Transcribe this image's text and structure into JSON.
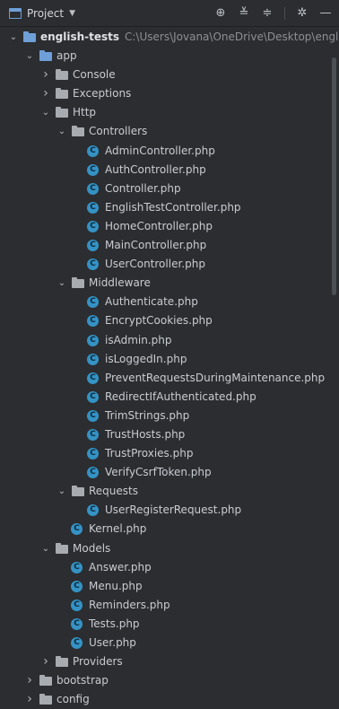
{
  "header": {
    "title": "Project",
    "caret_icon": "dropdown-caret-icon",
    "tools": [
      "locate-icon",
      "expand-all-icon",
      "collapse-all-icon",
      "settings-icon",
      "hide-icon"
    ]
  },
  "tree": [
    {
      "label": "english-tests",
      "path": "C:\\Users\\Jovana\\OneDrive\\Desktop\\english-t",
      "type": "folder-blue",
      "expanded": true,
      "depth": 0,
      "bold": true
    },
    {
      "label": "app",
      "type": "folder-blue",
      "expanded": true,
      "depth": 1
    },
    {
      "label": "Console",
      "type": "folder",
      "expanded": false,
      "depth": 2
    },
    {
      "label": "Exceptions",
      "type": "folder",
      "expanded": false,
      "depth": 2
    },
    {
      "label": "Http",
      "type": "folder",
      "expanded": true,
      "depth": 2
    },
    {
      "label": "Controllers",
      "type": "folder",
      "expanded": true,
      "depth": 3
    },
    {
      "label": "AdminController.php",
      "type": "class",
      "depth": 4
    },
    {
      "label": "AuthController.php",
      "type": "class",
      "depth": 4
    },
    {
      "label": "Controller.php",
      "type": "class",
      "depth": 4
    },
    {
      "label": "EnglishTestController.php",
      "type": "class",
      "depth": 4
    },
    {
      "label": "HomeController.php",
      "type": "class",
      "depth": 4
    },
    {
      "label": "MainController.php",
      "type": "class",
      "depth": 4
    },
    {
      "label": "UserController.php",
      "type": "class",
      "depth": 4
    },
    {
      "label": "Middleware",
      "type": "folder",
      "expanded": true,
      "depth": 3
    },
    {
      "label": "Authenticate.php",
      "type": "class",
      "depth": 4
    },
    {
      "label": "EncryptCookies.php",
      "type": "class",
      "depth": 4
    },
    {
      "label": "isAdmin.php",
      "type": "class",
      "depth": 4
    },
    {
      "label": "isLoggedIn.php",
      "type": "class",
      "depth": 4
    },
    {
      "label": "PreventRequestsDuringMaintenance.php",
      "type": "class",
      "depth": 4
    },
    {
      "label": "RedirectIfAuthenticated.php",
      "type": "class",
      "depth": 4
    },
    {
      "label": "TrimStrings.php",
      "type": "class",
      "depth": 4
    },
    {
      "label": "TrustHosts.php",
      "type": "class",
      "depth": 4
    },
    {
      "label": "TrustProxies.php",
      "type": "class",
      "depth": 4
    },
    {
      "label": "VerifyCsrfToken.php",
      "type": "class",
      "depth": 4
    },
    {
      "label": "Requests",
      "type": "folder",
      "expanded": true,
      "depth": 3
    },
    {
      "label": "UserRegisterRequest.php",
      "type": "class",
      "depth": 4
    },
    {
      "label": "Kernel.php",
      "type": "class",
      "depth": 3
    },
    {
      "label": "Models",
      "type": "folder",
      "expanded": true,
      "depth": 2
    },
    {
      "label": "Answer.php",
      "type": "class",
      "depth": 3
    },
    {
      "label": "Menu.php",
      "type": "class",
      "depth": 3
    },
    {
      "label": "Reminders.php",
      "type": "class",
      "depth": 3
    },
    {
      "label": "Tests.php",
      "type": "class",
      "depth": 3
    },
    {
      "label": "User.php",
      "type": "class",
      "depth": 3
    },
    {
      "label": "Providers",
      "type": "folder",
      "expanded": false,
      "depth": 2
    },
    {
      "label": "bootstrap",
      "type": "folder",
      "expanded": false,
      "depth": 1
    },
    {
      "label": "config",
      "type": "folder",
      "expanded": false,
      "depth": 1
    }
  ],
  "colors": {
    "background": "#2b2d30",
    "text": "#c9ccd1",
    "class_icon": "#3592c4",
    "module_folder": "#6f9fd8",
    "folder": "#a8abb0"
  }
}
